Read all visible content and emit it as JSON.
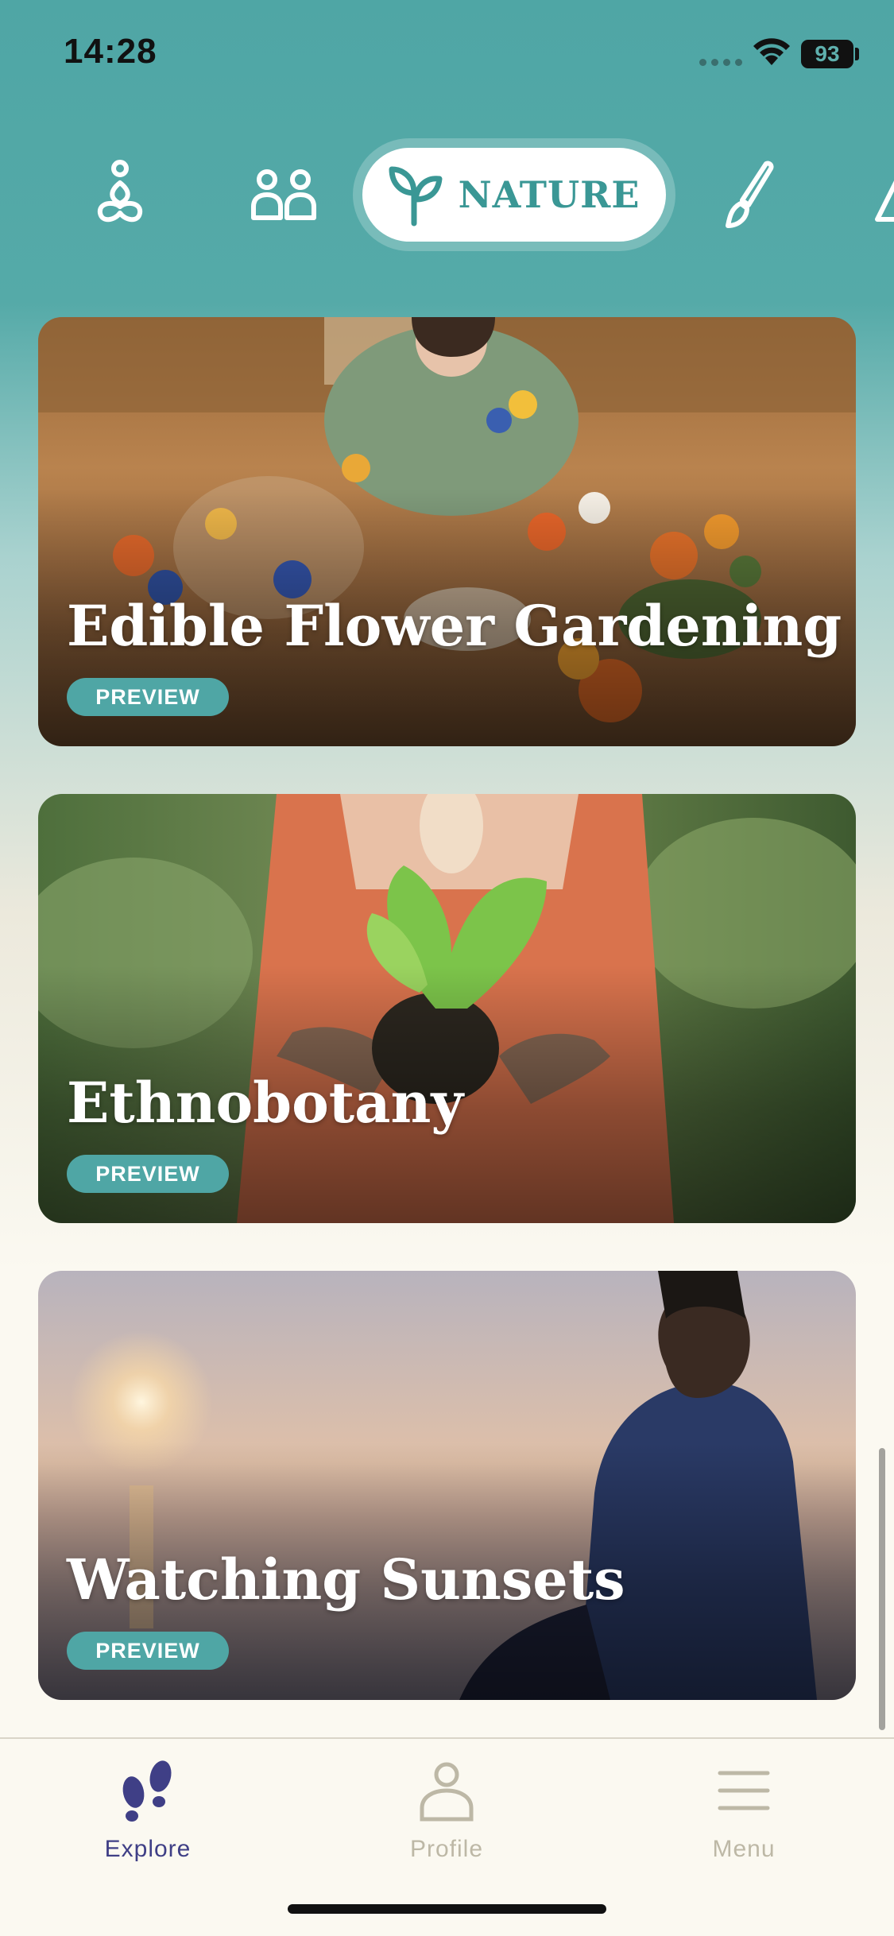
{
  "status_bar": {
    "time": "14:28",
    "battery": "93"
  },
  "categories": {
    "active_label": "NATURE",
    "icons": [
      "meditation-icon",
      "people-icon",
      "sprout-icon",
      "paintbrush-icon",
      "triangle-icon"
    ]
  },
  "cards": [
    {
      "title": "Edible Flower Gardening",
      "badge": "PREVIEW"
    },
    {
      "title": "Ethnobotany",
      "badge": "PREVIEW"
    },
    {
      "title": "Watching Sunsets",
      "badge": "PREVIEW"
    }
  ],
  "bottom_nav": {
    "items": [
      {
        "label": "Explore",
        "icon": "footprints-icon",
        "active": true
      },
      {
        "label": "Profile",
        "icon": "person-icon",
        "active": false
      },
      {
        "label": "Menu",
        "icon": "hamburger-icon",
        "active": false
      }
    ]
  },
  "colors": {
    "accent": "#4fa6a5",
    "active_nav": "#3f3f86",
    "inactive_nav": "#bdb8a6"
  }
}
